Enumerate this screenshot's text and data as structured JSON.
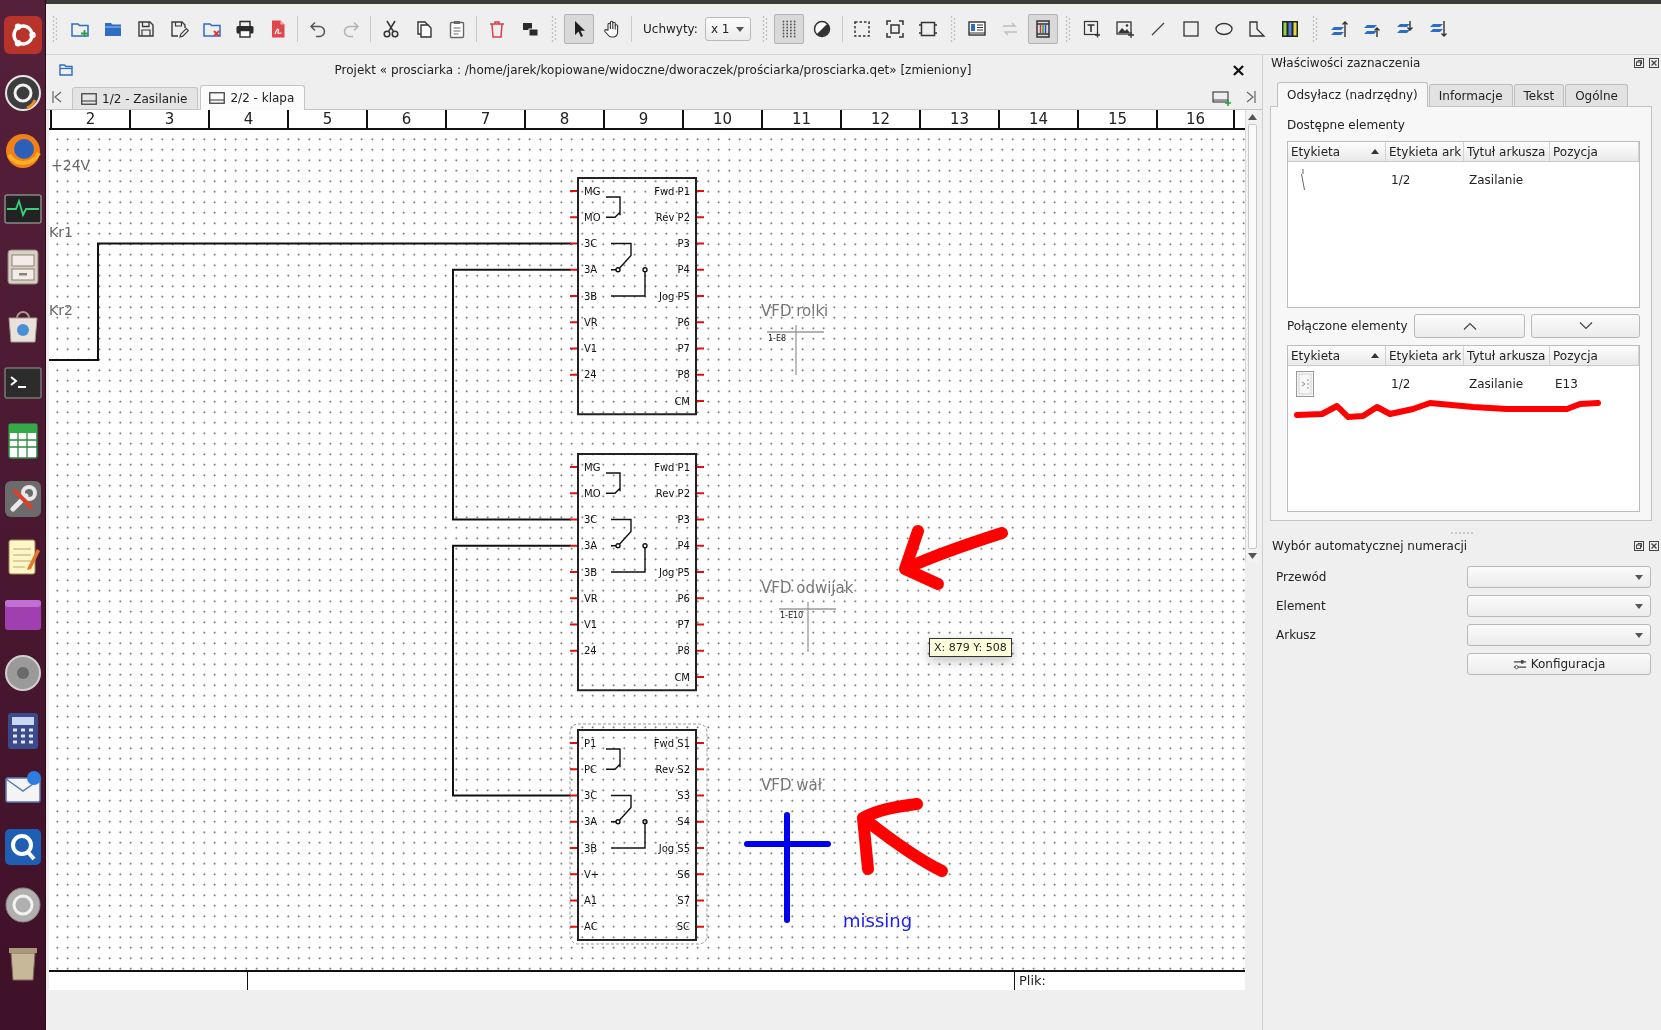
{
  "toolbars": [
    {
      "groups": [
        {
          "buttons": [
            {
              "kind": "new",
              "pressed": false,
              "disabled": false
            },
            {
              "kind": "open",
              "pressed": false,
              "disabled": false
            },
            {
              "kind": "save",
              "pressed": false,
              "disabled": false
            },
            {
              "kind": "saveas",
              "pressed": false,
              "disabled": false
            },
            {
              "kind": "closeproject",
              "pressed": false,
              "disabled": false
            },
            {
              "kind": "print",
              "pressed": false,
              "disabled": false
            },
            {
              "kind": "pdf",
              "pressed": false,
              "disabled": false
            }
          ]
        },
        {
          "buttons": [
            {
              "kind": "undo",
              "pressed": false,
              "disabled": false
            },
            {
              "kind": "redo",
              "pressed": false,
              "disabled": true
            }
          ]
        },
        {
          "buttons": [
            {
              "kind": "cut",
              "pressed": false,
              "disabled": false
            },
            {
              "kind": "copy",
              "pressed": false,
              "disabled": false
            },
            {
              "kind": "paste",
              "pressed": false,
              "disabled": false
            }
          ]
        },
        {
          "buttons": [
            {
              "kind": "delete",
              "pressed": false,
              "disabled": false
            },
            {
              "kind": "rotate",
              "pressed": false,
              "disabled": false
            }
          ]
        }
      ]
    },
    {
      "groups": [
        {
          "buttons": [
            {
              "kind": "select",
              "pressed": true,
              "disabled": false
            },
            {
              "kind": "pan",
              "pressed": false,
              "disabled": false
            }
          ]
        },
        {
          "handles": {
            "label": "Uchwyty:",
            "value": "x 1"
          }
        }
      ]
    },
    {
      "groups": [
        {
          "buttons": [
            {
              "kind": "grid",
              "pressed": true,
              "disabled": false
            },
            {
              "kind": "contrast",
              "pressed": false,
              "disabled": false
            }
          ]
        },
        {
          "buttons": [
            {
              "kind": "selectall",
              "pressed": false,
              "disabled": false
            },
            {
              "kind": "fit",
              "pressed": false,
              "disabled": false
            },
            {
              "kind": "zoomreset",
              "pressed": false,
              "disabled": false
            }
          ]
        }
      ]
    },
    {
      "groups": [
        {
          "buttons": [
            {
              "kind": "titleblock",
              "pressed": false,
              "disabled": false
            },
            {
              "kind": "swap",
              "pressed": false,
              "disabled": true
            },
            {
              "kind": "conductors",
              "pressed": true,
              "disabled": false
            }
          ]
        }
      ]
    },
    {
      "groups": [
        {
          "buttons": [
            {
              "kind": "text",
              "pressed": false,
              "disabled": false
            },
            {
              "kind": "image",
              "pressed": false,
              "disabled": false
            },
            {
              "kind": "line",
              "pressed": false,
              "disabled": false
            },
            {
              "kind": "rectangle",
              "pressed": false,
              "disabled": false
            },
            {
              "kind": "ellipse",
              "pressed": false,
              "disabled": false
            },
            {
              "kind": "polygon",
              "pressed": false,
              "disabled": false
            },
            {
              "kind": "terminals",
              "pressed": false,
              "disabled": false
            }
          ]
        }
      ]
    },
    {
      "groups": [
        {
          "buttons": [
            {
              "kind": "top",
              "pressed": false,
              "disabled": false
            },
            {
              "kind": "raise",
              "pressed": false,
              "disabled": false
            },
            {
              "kind": "lower",
              "pressed": false,
              "disabled": false
            },
            {
              "kind": "bottom",
              "pressed": false,
              "disabled": false
            }
          ]
        }
      ]
    }
  ],
  "document": {
    "title": "Projekt « prosciarka : /home/jarek/kopiowane/widoczne/dworaczek/prościarka/prosciarka.qet» [zmieniony]",
    "sheet_tabs": [
      {
        "label": "1/2 - Zasilanie",
        "selected": false
      },
      {
        "label": "2/2 - klapa",
        "selected": true
      }
    ],
    "ruler": [
      "2",
      "3",
      "4",
      "5",
      "6",
      "7",
      "8",
      "9",
      "10",
      "11",
      "12",
      "13",
      "14",
      "15",
      "16"
    ],
    "diagram": {
      "net_labels": [
        "+24V",
        "Kr1",
        "Kr2"
      ],
      "drives": [
        {
          "selected": false,
          "left_pins": [
            "MG",
            "MO",
            "3C",
            "3A",
            "3B",
            "VR",
            "V1",
            "24"
          ],
          "right_pins": [
            "Fwd P1",
            "Rev P2",
            "P3",
            "P4",
            "Jog P5",
            "P6",
            "P7",
            "P8",
            "CM"
          ]
        },
        {
          "selected": false,
          "left_pins": [
            "MG",
            "MO",
            "3C",
            "3A",
            "3B",
            "VR",
            "V1",
            "24"
          ],
          "right_pins": [
            "Fwd P1",
            "Rev P2",
            "P3",
            "P4",
            "Jog P5",
            "P6",
            "P7",
            "P8",
            "CM"
          ]
        },
        {
          "selected": true,
          "left_pins": [
            "P1",
            "PC",
            "3C",
            "3A",
            "3B",
            "V+",
            "A1",
            "AC"
          ],
          "right_pins": [
            "Fwd S1",
            "Rev S2",
            "S3",
            "S4",
            "Jog S5",
            "S6",
            "S7",
            "SC"
          ]
        }
      ],
      "references": [
        {
          "label": "VFD rolki",
          "xref": "1-E8"
        },
        {
          "label": "VFD odwijak",
          "xref": "1-E10"
        },
        {
          "label": "VFD wał"
        }
      ],
      "tooltip": "X: 879 Y: 508",
      "annotation": "missing"
    },
    "title_block": {
      "file_label": "Plik:"
    }
  },
  "properties_dock": {
    "title": "Właściwości zaznaczenia",
    "tabs": [
      {
        "label": "Odsyłacz (nadrzędny)",
        "selected": true
      },
      {
        "label": "Informacje",
        "selected": false
      },
      {
        "label": "Tekst",
        "selected": false
      },
      {
        "label": "Ogólne",
        "selected": false
      }
    ],
    "available": {
      "heading": "Dostępne elementy",
      "columns": [
        {
          "label": "Etykieta",
          "sorted": true
        },
        {
          "label": "Etykieta ark",
          "sorted": false
        },
        {
          "label": "Tytuł arkusza",
          "sorted": false
        },
        {
          "label": "Pozycja",
          "sorted": false
        }
      ],
      "rows": [
        {
          "sheet_label": "1/2",
          "sheet_title": "Zasilanie"
        }
      ]
    },
    "linked": {
      "heading": "Połączone elementy",
      "columns": [
        {
          "label": "Etykieta",
          "sorted": true
        },
        {
          "label": "Etykieta ark",
          "sorted": false
        },
        {
          "label": "Tytuł arkusza",
          "sorted": false
        },
        {
          "label": "Pozycja",
          "sorted": false
        }
      ],
      "rows": [
        {
          "sheet_label": "1/2",
          "sheet_title": "Zasilanie",
          "position": "E13"
        }
      ]
    }
  },
  "autonumber_dock": {
    "title": "Wybór automatycznej numeracji",
    "fields": [
      {
        "label": "Przewód"
      },
      {
        "label": "Element"
      },
      {
        "label": "Arkusz"
      }
    ],
    "button": "Konfiguracja"
  }
}
